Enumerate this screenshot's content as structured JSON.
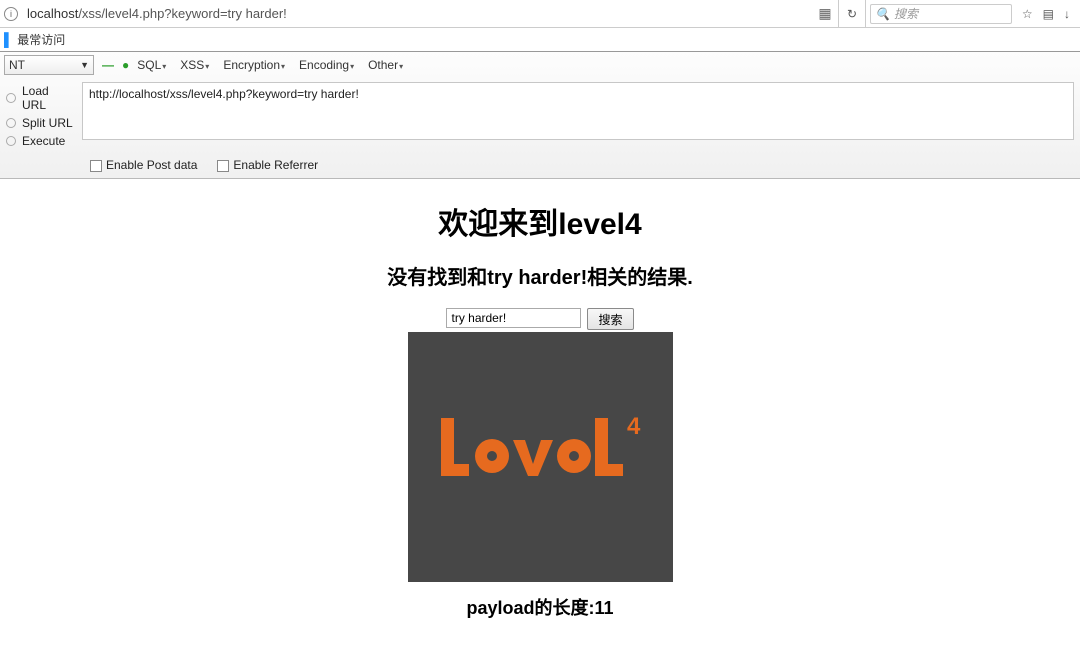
{
  "browser": {
    "info_icon": "i",
    "url_display": "localhost/xss/level4.php?keyword=try harder!",
    "url_host": "localhost",
    "url_path": "/xss/level4.php?keyword=try harder!",
    "qr_icon": "▦",
    "refresh_icon": "↻",
    "search_placeholder": "搜索",
    "star_icon": "☆",
    "clipboard_icon": "▤",
    "download_icon": "↓"
  },
  "bookmark": {
    "label": "最常访问"
  },
  "hackbar": {
    "dropdown_value": "NT",
    "menus": [
      "SQL",
      "XSS",
      "Encryption",
      "Encoding",
      "Other"
    ],
    "load_url": "Load URL",
    "split_url": "Split URL",
    "execute": "Execute",
    "textarea_value": "http://localhost/xss/level4.php?keyword=try harder!",
    "cb_post": "Enable Post data",
    "cb_ref": "Enable Referrer"
  },
  "page": {
    "title": "欢迎来到level4",
    "subtitle": "没有找到和try harder!相关的结果.",
    "input_value": "try harder!",
    "search_btn": "搜索",
    "image_text_main": "level",
    "image_text_sup": "4",
    "payload_label": "payload的长度:11"
  }
}
